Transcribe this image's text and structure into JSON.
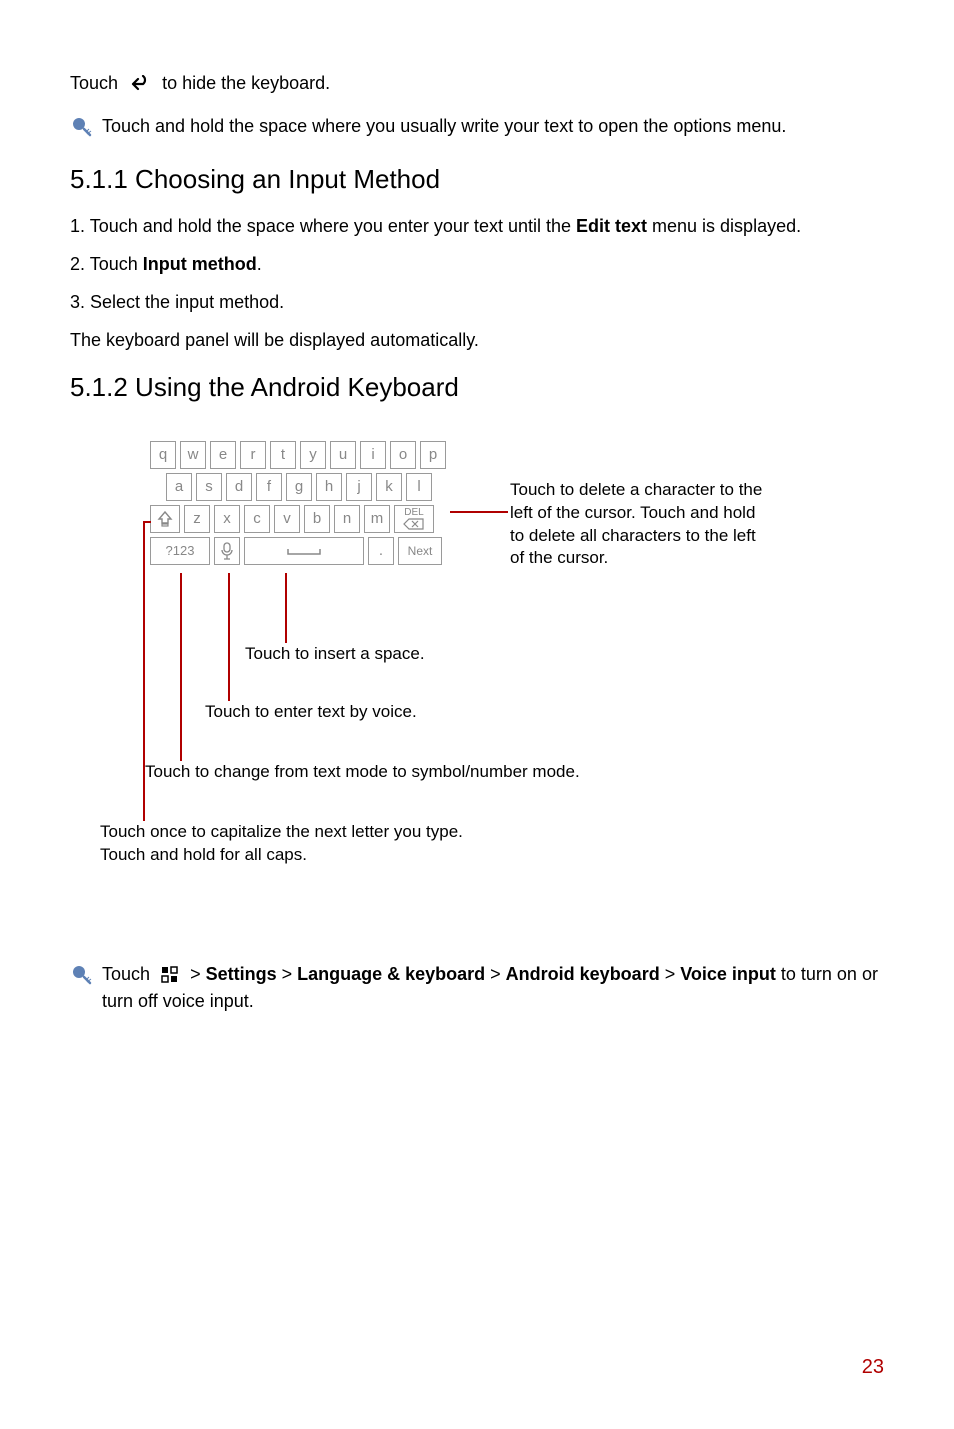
{
  "p1_prefix": "Touch ",
  "p1_suffix": " to hide the keyboard.",
  "tip1": "Touch and hold the space where you usually write your text to open the options menu.",
  "h511": "5.1.1  Choosing an Input Method",
  "ol1_a": "1. Touch and hold the space where you enter your text until the ",
  "ol1_b": "Edit text",
  "ol1_c": " menu is displayed.",
  "ol2_a": "2. Touch ",
  "ol2_b": "Input method",
  "ol2_c": ".",
  "ol3": "3. Select the input method.",
  "p2": "The keyboard panel will be displayed automatically.",
  "h512": "5.1.2  Using the Android Keyboard",
  "kbd": {
    "r1": [
      "q",
      "w",
      "e",
      "r",
      "t",
      "y",
      "u",
      "i",
      "o",
      "p"
    ],
    "r2": [
      "a",
      "s",
      "d",
      "f",
      "g",
      "h",
      "j",
      "k",
      "l"
    ],
    "r3": [
      "z",
      "x",
      "c",
      "v",
      "b",
      "n",
      "m"
    ],
    "del_top": "DEL",
    "q123": "?123",
    "dot": ".",
    "next": "Next"
  },
  "callouts": {
    "del": "Touch to delete a character to the left of the cursor. Touch and hold to delete all characters to the left of the cursor.",
    "space": "Touch to insert a space.",
    "voice": "Touch to enter text by voice.",
    "mode": "Touch to change from text mode to symbol/number mode.",
    "caps1": "Touch once to capitalize the next letter you type.",
    "caps2": "Touch and hold for all caps."
  },
  "tip2_a": "Touch ",
  "tip2_b": " > ",
  "tip2_settings": "Settings",
  "tip2_lang": "Language & keyboard",
  "tip2_android": "Android keyboard",
  "tip2_voice": "Voice input",
  "tip2_end": " to turn on or turn off voice input.",
  "page": "23"
}
